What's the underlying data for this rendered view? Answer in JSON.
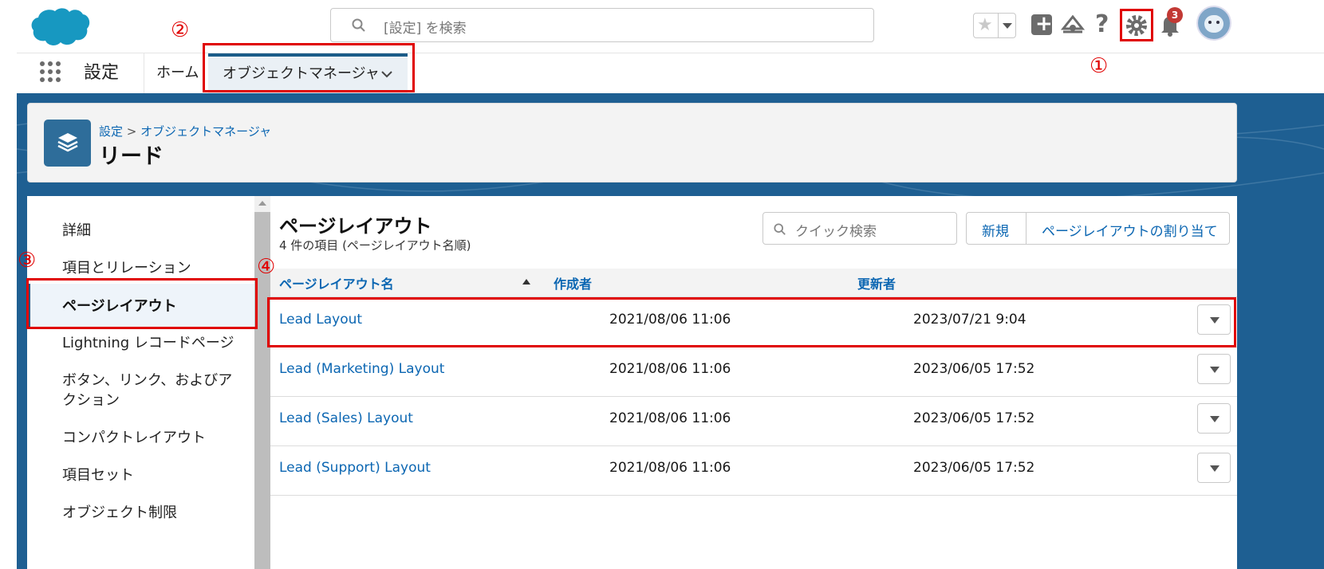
{
  "top": {
    "search_placeholder": "[設定] を検索",
    "notif_count": "3"
  },
  "nav": {
    "app_name": "設定",
    "tabs": [
      "ホーム",
      "オブジェクトマネージャ"
    ]
  },
  "header": {
    "breadcrumb_root": "設定",
    "breadcrumb_sep": ">",
    "breadcrumb_current": "オブジェクトマネージャ",
    "title": "リード"
  },
  "sidebar": {
    "items": [
      "詳細",
      "項目とリレーション",
      "ページレイアウト",
      "Lightning レコードページ",
      "ボタン、リンク、およびア",
      "クション",
      "コンパクトレイアウト",
      "項目セット",
      "オブジェクト制限"
    ]
  },
  "main": {
    "title": "ページレイアウト",
    "subtitle": "4 件の項目 (ページレイアウト名順)",
    "quick_search_placeholder": "クイック検索",
    "new_label": "新規",
    "assign_label": "ページレイアウトの割り当て",
    "columns": [
      "ページレイアウト名",
      "作成者",
      "更新者"
    ],
    "rows": [
      {
        "name": "Lead Layout",
        "created": "2021/08/06 11:06",
        "modified": "2023/07/21 9:04"
      },
      {
        "name": "Lead (Marketing) Layout",
        "created": "2021/08/06 11:06",
        "modified": "2023/06/05 17:52"
      },
      {
        "name": "Lead (Sales) Layout",
        "created": "2021/08/06 11:06",
        "modified": "2023/06/05 17:52"
      },
      {
        "name": "Lead (Support) Layout",
        "created": "2021/08/06 11:06",
        "modified": "2023/06/05 17:52"
      }
    ]
  },
  "annotations": [
    "①",
    "②",
    "③",
    "④"
  ],
  "colors": {
    "accent": "#0b66b2",
    "highlight": "#e00000",
    "banner": "#1e5f92",
    "cloud": "#1798c1"
  }
}
